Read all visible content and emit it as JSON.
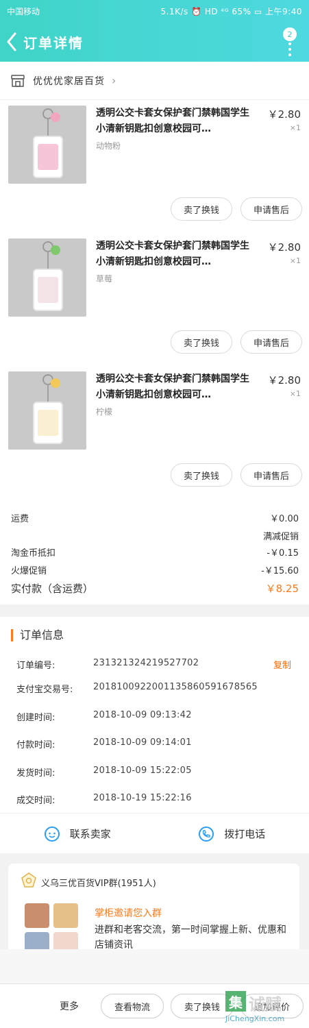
{
  "status_bar": {
    "carrier": "中国移动",
    "indicators": "5.1K/s ⏰ HD ⁴ᴳ 65% ▭ 上午9:40"
  },
  "header": {
    "title": "订单详情",
    "badge_count": "2"
  },
  "shop": {
    "name": "优优优家居百货"
  },
  "items": [
    {
      "title": "透明公交卡套女保护套门禁韩国学生小清新钥匙扣创意校园可…",
      "sku": "动物粉",
      "price": "￥2.80",
      "qty": "×1",
      "card_color": "#f6c6d8",
      "bead_color": "#f1a6c0",
      "btn_refund": "卖了换钱",
      "btn_aftersale": "申请售后"
    },
    {
      "title": "透明公交卡套女保护套门禁韩国学生小清新钥匙扣创意校园可…",
      "sku": "草莓",
      "price": "￥2.80",
      "qty": "×1",
      "card_color": "#f3e3e6",
      "bead_color": "#7fc86b",
      "btn_refund": "卖了换钱",
      "btn_aftersale": "申请售后"
    },
    {
      "title": "透明公交卡套女保护套门禁韩国学生小清新钥匙扣创意校园可…",
      "sku": "柠檬",
      "price": "￥2.80",
      "qty": "×1",
      "card_color": "#fbefd2",
      "bead_color": "#f2c85a",
      "btn_refund": "卖了换钱",
      "btn_aftersale": "申请售后"
    }
  ],
  "fees": {
    "shipping_label": "运费",
    "shipping_value": "￥0.00",
    "promo_note": "满减促销",
    "taojinbi_label": "淘金币抵扣",
    "taojinbi_value": "-￥0.15",
    "huobao_label": "火爆促销",
    "huobao_value": "-￥15.60",
    "total_label": "实付款（含运费）",
    "total_value": "￥8.25"
  },
  "order_info": {
    "heading": "订单信息",
    "order_no_label": "订单编号:",
    "order_no": "231321324219527702",
    "copy_label": "复制",
    "alipay_label": "支付宝交易号:",
    "alipay_no": "2018100922001135860591678565",
    "created_label": "创建时间:",
    "created": "2018-10-09 09:13:42",
    "paid_label": "付款时间:",
    "paid": "2018-10-09 09:14:01",
    "shipped_label": "发货时间:",
    "shipped": "2018-10-09 15:22:05",
    "done_label": "成交时间:",
    "done": "2018-10-19 15:22:16",
    "contact_seller": "联系卖家",
    "call_phone": "拨打电话"
  },
  "group": {
    "title": "义乌三优百货VIP群(1951人)",
    "invite": "掌柜邀请您入群",
    "desc": "进群和老客交流，第一时间掌握上新、优惠和店铺资讯"
  },
  "bottom_bar": {
    "more": "更多",
    "logistics": "查看物流",
    "sell": "卖了换钱",
    "review": "追加评价"
  },
  "watermark": {
    "mark": "集",
    "big": "诚赋",
    "small": "JiChengXin.com"
  }
}
